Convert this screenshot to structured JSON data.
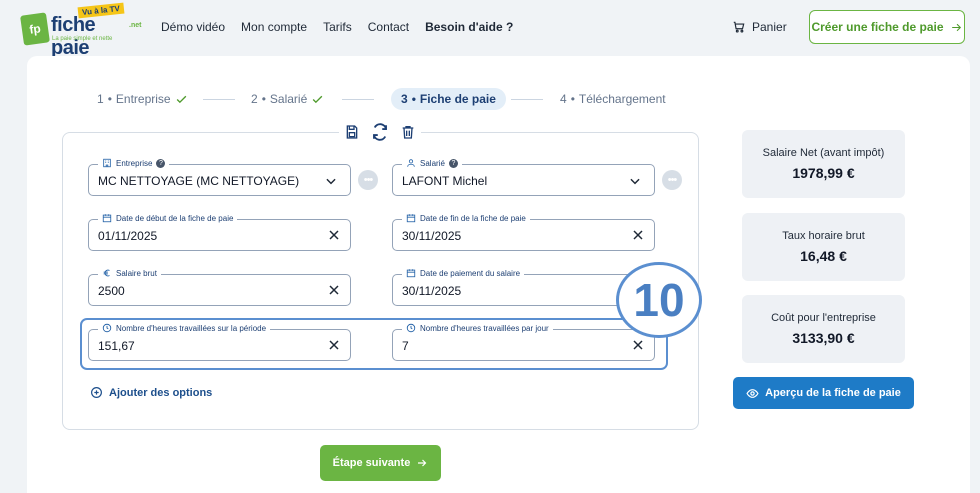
{
  "header": {
    "logo_word": "fiche paie",
    "logo_badge": "Vu à la TV",
    "logo_net": ".net",
    "logo_tagline": "La paie simple et nette",
    "nav": [
      "Démo vidéo",
      "Mon compte",
      "Tarifs",
      "Contact",
      "Besoin d'aide ?"
    ],
    "cart_label": "Panier",
    "cta_label": "Créer une fiche de paie"
  },
  "stepper": {
    "steps": [
      {
        "num": "1",
        "label": "Entreprise",
        "state": "done"
      },
      {
        "num": "2",
        "label": "Salarié",
        "state": "done"
      },
      {
        "num": "3",
        "label": "Fiche de paie",
        "state": "active"
      },
      {
        "num": "4",
        "label": "Téléchargement",
        "state": "todo"
      }
    ],
    "separator": "•"
  },
  "form": {
    "entreprise": {
      "label": "Entreprise",
      "value": "MC NETTOYAGE (MC NETTOYAGE)"
    },
    "salarie": {
      "label": "Salarié",
      "value": "LAFONT Michel"
    },
    "date_debut": {
      "label": "Date de début de la fiche de paie",
      "value": "01/11/2025"
    },
    "date_fin": {
      "label": "Date de fin de la fiche de paie",
      "value": "30/11/2025"
    },
    "salaire_brut": {
      "label": "Salaire brut",
      "value": "2500"
    },
    "date_paiement": {
      "label": "Date de paiement du salaire",
      "value": "30/11/2025"
    },
    "heures_periode": {
      "label": "Nombre d'heures travaillées sur la période",
      "value": "151,67"
    },
    "heures_jour": {
      "label": "Nombre d'heures travaillées par jour",
      "value": "7"
    },
    "add_options": "Ajouter des options",
    "more_glyph": "•••",
    "help_glyph": "?"
  },
  "annotation": {
    "step_number": "10"
  },
  "next_button": "Étape suivante",
  "summary": [
    {
      "title": "Salaire Net (avant impôt)",
      "value": "1978,99 €"
    },
    {
      "title": "Taux horaire brut",
      "value": "16,48 €"
    },
    {
      "title": "Coût pour l'entreprise",
      "value": "3133,90 €"
    }
  ],
  "preview_button": "Aperçu de la fiche de paie",
  "colors": {
    "accent_green": "#6bb543",
    "accent_blue": "#1e7bc7",
    "highlight": "#5b8fd0"
  }
}
